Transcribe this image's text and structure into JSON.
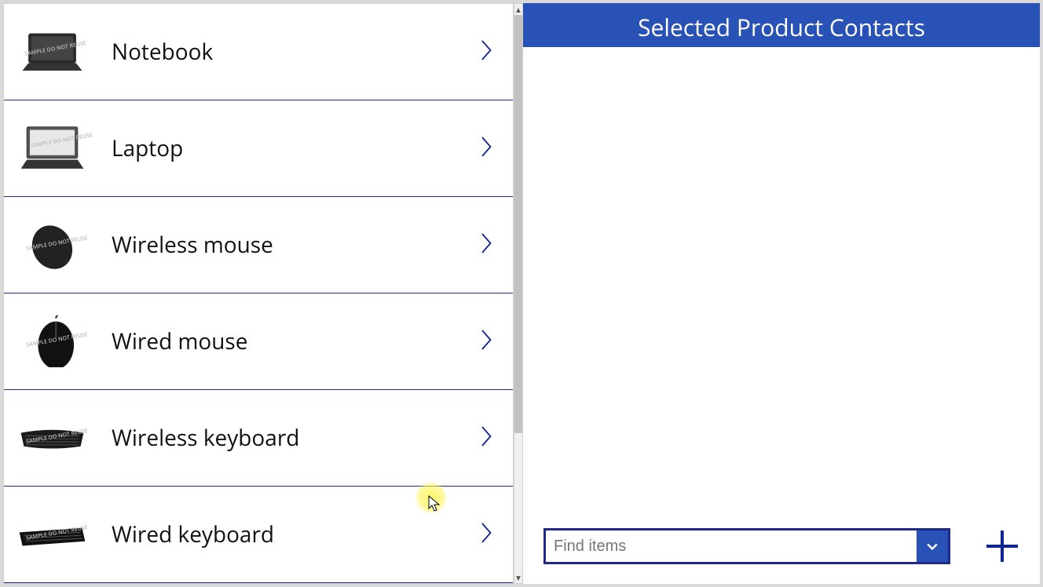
{
  "products": [
    {
      "label": "Notebook",
      "icon": "notebook"
    },
    {
      "label": "Laptop",
      "icon": "laptop"
    },
    {
      "label": "Wireless mouse",
      "icon": "mouse-wireless"
    },
    {
      "label": "Wired mouse",
      "icon": "mouse-wired"
    },
    {
      "label": "Wireless keyboard",
      "icon": "keyboard-wireless"
    },
    {
      "label": "Wired keyboard",
      "icon": "keyboard-wired"
    }
  ],
  "right": {
    "header": "Selected Product Contacts",
    "find_placeholder": "Find items"
  },
  "watermark": "SAMPLE\nDO NOT REUSE"
}
